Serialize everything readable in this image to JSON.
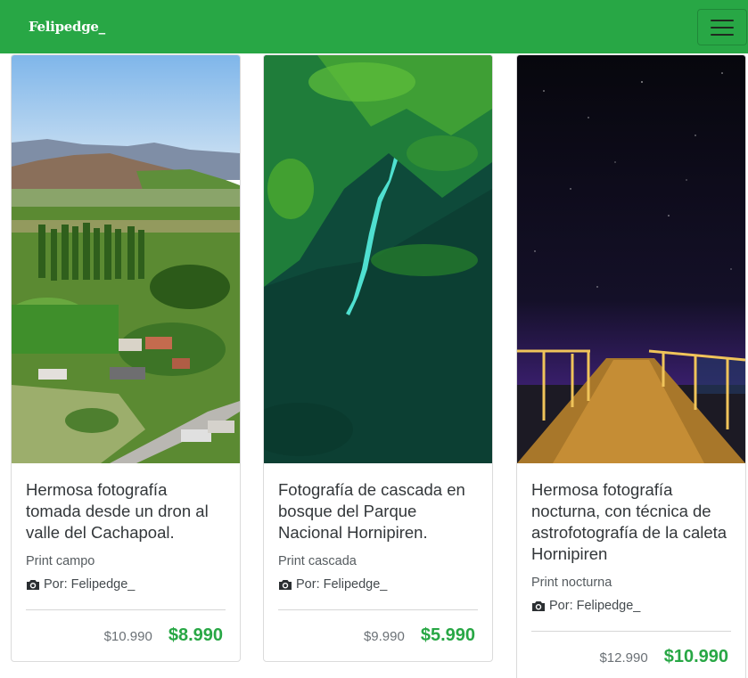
{
  "navbar": {
    "brand": "Felipedge_",
    "toggle_icon": "hamburger-menu-icon",
    "background": "#28a745"
  },
  "products": [
    {
      "title": "Hermosa fotografía tomada desde un dron al valle del Cachapoal.",
      "category": "Print campo",
      "author": "Por: Felipedge_",
      "old_price": "$10.990",
      "price": "$8.990"
    },
    {
      "title": "Fotografía de cascada en bosque del Parque Nacional Hornipiren.",
      "category": "Print cascada",
      "author": "Por: Felipedge_",
      "old_price": "$9.990",
      "price": "$5.990"
    },
    {
      "title": "Hermosa fotografía nocturna, con técnica de astrofotografía de la caleta Hornipiren",
      "category": "Print nocturna",
      "author": "Por: Felipedge_",
      "old_price": "$12.990",
      "price": "$10.990"
    }
  ],
  "colors": {
    "accent": "#28a745",
    "title_text": "#33373a"
  }
}
